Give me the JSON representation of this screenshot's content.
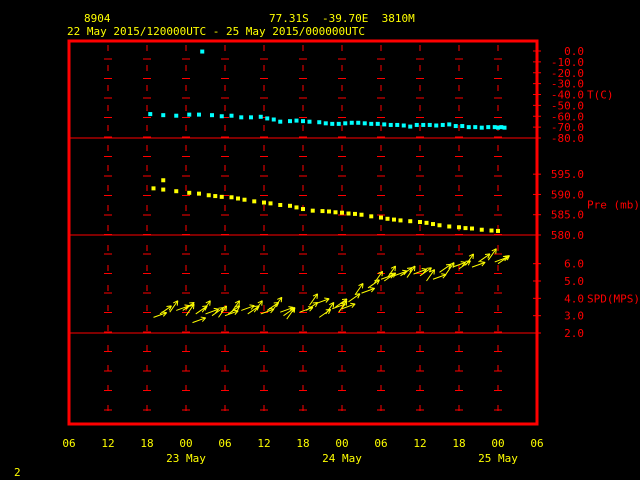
{
  "header": {
    "station": "8904",
    "coords": "77.31S  -39.70E  3810M",
    "time_range": "22 May 2015/120000UTC - 25 May 2015/000000UTC"
  },
  "footer": {
    "page_number": "2"
  },
  "colors": {
    "background": "#000000",
    "frame": "#ff0000",
    "temperature": "#00ffff",
    "pressure": "#ffff00",
    "wind": "#ffff00",
    "text_header": "#ffff00",
    "text_axis": "#ff0000",
    "text_dates": "#ffff00"
  },
  "chart_data": {
    "type": "line",
    "xaxis": {
      "tick_labels": [
        "06",
        "12",
        "18",
        "00",
        "06",
        "12",
        "18",
        "00",
        "06",
        "12",
        "18",
        "00",
        "06"
      ],
      "tick_hours": [
        0,
        6,
        12,
        18,
        24,
        30,
        36,
        42,
        48,
        54,
        60,
        66,
        72
      ],
      "date_labels": [
        {
          "label": "23 May",
          "hour": 18
        },
        {
          "label": "24 May",
          "hour": 42
        },
        {
          "label": "25 May",
          "hour": 66
        }
      ]
    },
    "panels": [
      {
        "name": "temperature",
        "axis_label": "T(C)",
        "ylim": [
          -80,
          0
        ],
        "tick_labels": [
          "0.0",
          "-10.0",
          "-20.0",
          "-30.0",
          "-40.0",
          "-50.0",
          "-60.0",
          "-70.0",
          "-80.0"
        ],
        "tick_values": [
          0,
          -10,
          -20,
          -30,
          -40,
          -50,
          -60,
          -70,
          -80
        ],
        "x": [
          20.5,
          21.5,
          21.5,
          22.5,
          24.0,
          25.5,
          26.5,
          27.0,
          27.5,
          28.5,
          29.5,
          30.5,
          31.5,
          32.5,
          33.5,
          34.5,
          35.0,
          36.0,
          37.0,
          38.0,
          39.0,
          40.0,
          41.0,
          41.5,
          42.0,
          42.5,
          43.0,
          44.0,
          45.0,
          46.0,
          47.0,
          48.0,
          49.0,
          50.0,
          51.0,
          52.0,
          53.0,
          54.0,
          55.0,
          56.0,
          57.0,
          58.0,
          59.0,
          60.0,
          61.0,
          62.0,
          63.0,
          64.0,
          65.0,
          66.0
        ],
        "y": [
          -0.5,
          -58.0,
          -59.0,
          -59.5,
          -58.5,
          -58.5,
          -59.0,
          -60.0,
          -59.5,
          -61.0,
          -61.0,
          -60.5,
          -62.0,
          -63.0,
          -65.0,
          -64.5,
          -64.0,
          -64.5,
          -65.0,
          -65.5,
          -66.5,
          -67.0,
          -67.0,
          -66.5,
          -66.0,
          -66.0,
          -66.5,
          -67.0,
          -67.0,
          -67.5,
          -68.0,
          -68.0,
          -68.5,
          -69.5,
          -68.0,
          -68.0,
          -68.0,
          -68.5,
          -68.0,
          -67.5,
          -69.0,
          -69.0,
          -70.0,
          -70.0,
          -70.5,
          -70.0,
          -70.0,
          -70.5,
          -70.0,
          -70.5
        ],
        "time_offset": [
          0,
          10,
          6,
          8,
          12,
          14,
          16,
          18,
          20,
          22,
          24,
          26,
          28,
          30,
          32,
          34,
          36,
          38,
          40,
          42,
          44,
          46,
          48,
          50,
          52,
          54,
          56,
          58,
          60,
          62,
          64,
          66,
          68,
          70,
          72,
          74,
          76,
          78,
          80,
          82,
          84,
          86,
          88,
          90,
          92,
          94,
          96,
          98,
          100,
          102
        ],
        "x_hours": [
          20.5,
          12.5,
          14.5,
          16.5,
          18.5,
          20.0,
          22.0,
          23.5,
          25.0,
          26.5,
          28.0,
          29.5,
          30.5,
          31.5,
          32.5,
          34.0,
          35.0,
          36.0,
          37.0,
          38.5,
          39.5,
          40.5,
          41.5,
          42.5,
          43.5,
          44.5,
          45.5,
          46.5,
          47.5,
          48.5,
          49.5,
          50.5,
          51.5,
          52.5,
          53.5,
          54.5,
          55.5,
          56.5,
          57.5,
          58.5,
          59.5,
          60.5,
          61.5,
          62.5,
          63.5,
          64.5,
          65.5,
          66.0,
          66.5,
          67.0
        ],
        "note": "first value is the isolated point near 0 C"
      },
      {
        "name": "pressure",
        "axis_label": "Pre (mb)",
        "ylim": [
          580,
          598
        ],
        "tick_labels": [
          "595.0",
          "590.0",
          "585.0",
          "580.0"
        ],
        "tick_values": [
          595,
          590,
          585,
          580
        ],
        "x_hours": [
          14.5,
          13.0,
          14.5,
          16.5,
          18.5,
          20.0,
          21.5,
          22.5,
          23.5,
          25.0,
          26.0,
          27.0,
          28.5,
          30.0,
          31.0,
          32.5,
          34.0,
          35.0,
          36.0,
          37.5,
          39.0,
          40.0,
          41.0,
          42.0,
          43.0,
          44.0,
          45.0,
          46.5,
          48.0,
          49.0,
          50.0,
          51.0,
          52.5,
          54.0,
          55.0,
          56.0,
          57.0,
          58.5,
          60.0,
          61.0,
          62.0,
          63.5,
          65.0,
          66.0
        ],
        "y": [
          593.5,
          591.5,
          591.2,
          590.8,
          590.4,
          590.2,
          589.8,
          589.6,
          589.4,
          589.3,
          589.0,
          588.7,
          588.3,
          588.0,
          587.8,
          587.4,
          587.2,
          586.8,
          586.4,
          586.0,
          585.9,
          585.8,
          585.6,
          585.5,
          585.3,
          585.2,
          585.0,
          584.6,
          584.3,
          584.0,
          583.8,
          583.6,
          583.4,
          583.2,
          583.0,
          582.7,
          582.4,
          582.1,
          581.9,
          581.7,
          581.6,
          581.3,
          581.1,
          581.0
        ]
      },
      {
        "name": "wind_speed",
        "axis_label": "SPD(MPS)",
        "ylim": [
          2,
          6.5
        ],
        "tick_labels": [
          "6.0",
          "5.0",
          "4.0",
          "3.0",
          "2.0"
        ],
        "tick_values": [
          6,
          5,
          4,
          3,
          2
        ],
        "x_hours": [
          13.0,
          14.0,
          15.5,
          16.5,
          17.5,
          18.0,
          19.0,
          19.5,
          20.5,
          21.0,
          22.0,
          23.0,
          24.0,
          24.5,
          25.0,
          26.5,
          27.5,
          28.5,
          29.5,
          30.5,
          31.5,
          32.5,
          33.0,
          33.5,
          35.5,
          36.5,
          37.0,
          38.0,
          38.5,
          39.5,
          40.5,
          41.0,
          41.5,
          42.0,
          43.0,
          44.0,
          45.0,
          46.0,
          47.0,
          48.0,
          48.5,
          49.0,
          50.0,
          51.0,
          52.0,
          53.0,
          54.0,
          55.0,
          56.0,
          57.0,
          58.0,
          59.0,
          60.0,
          61.0,
          62.0,
          63.0,
          64.5,
          65.5,
          66.0
        ],
        "y": [
          2.9,
          3.1,
          3.2,
          3.3,
          3.3,
          3.0,
          2.6,
          3.1,
          3.2,
          3.1,
          3.0,
          2.9,
          3.0,
          3.1,
          3.2,
          3.3,
          3.1,
          3.2,
          3.1,
          3.3,
          3.4,
          3.2,
          3.0,
          2.8,
          3.2,
          3.3,
          3.6,
          3.7,
          2.9,
          3.1,
          3.4,
          3.5,
          3.2,
          3.4,
          3.8,
          4.2,
          4.3,
          4.6,
          4.9,
          5.1,
          5.0,
          5.2,
          5.3,
          5.3,
          5.2,
          5.4,
          5.3,
          5.0,
          5.1,
          5.5,
          5.4,
          5.8,
          5.7,
          5.9,
          5.8,
          6.1,
          6.2,
          6.1,
          6.0
        ]
      }
    ]
  }
}
